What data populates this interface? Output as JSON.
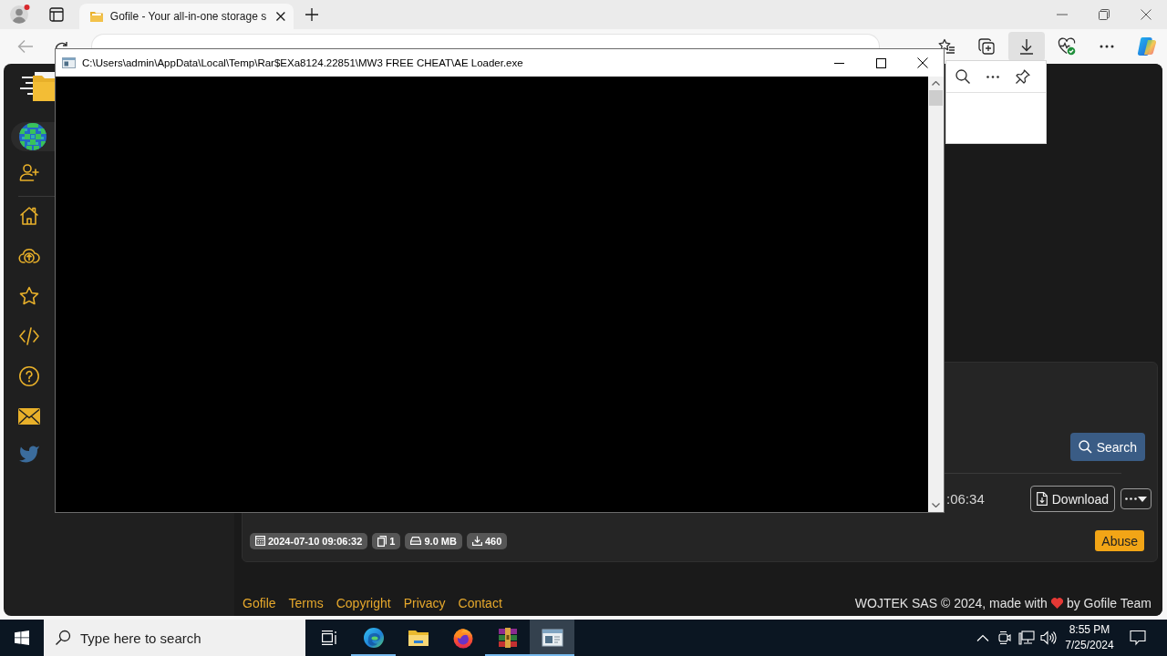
{
  "browser": {
    "tabs": [
      {
        "title": "Gofile - Your all-in-one storage s",
        "selected": true
      }
    ],
    "toolbar_buttons": [
      {
        "selected": false
      },
      {
        "selected": false
      },
      {
        "selected": true
      },
      {
        "selected": false
      },
      {
        "selected": false
      },
      {
        "selected": false
      }
    ]
  },
  "page": {
    "search_button": "Search",
    "file_row": {
      "date": ":06:34",
      "download_button": "Download"
    },
    "badges": [
      "2024-07-10 09:06:32",
      "1",
      "9.0 MB",
      "460"
    ],
    "abuse_button": "Abuse",
    "footer": {
      "links": [
        "Gofile",
        "Terms",
        "Copyright",
        "Privacy",
        "Contact"
      ],
      "credit_before": "WOJTEK SAS © 2024, made with",
      "credit_after": "by Gofile Team"
    }
  },
  "console_window": {
    "title": "C:\\Users\\admin\\AppData\\Local\\Temp\\Rar$EXa8124.22851\\MW3 FREE CHEAT\\AE Loader.exe"
  },
  "taskbar": {
    "search": {
      "placeholder": "Type here to search"
    },
    "apps": [
      {
        "running": true,
        "selected": false
      },
      {
        "running": false,
        "selected": false
      },
      {
        "running": false,
        "selected": false
      },
      {
        "running": true,
        "selected": false
      },
      {
        "running": true,
        "selected": true
      }
    ],
    "clock": {
      "time": "8:55 PM",
      "date": "7/25/2024"
    }
  }
}
